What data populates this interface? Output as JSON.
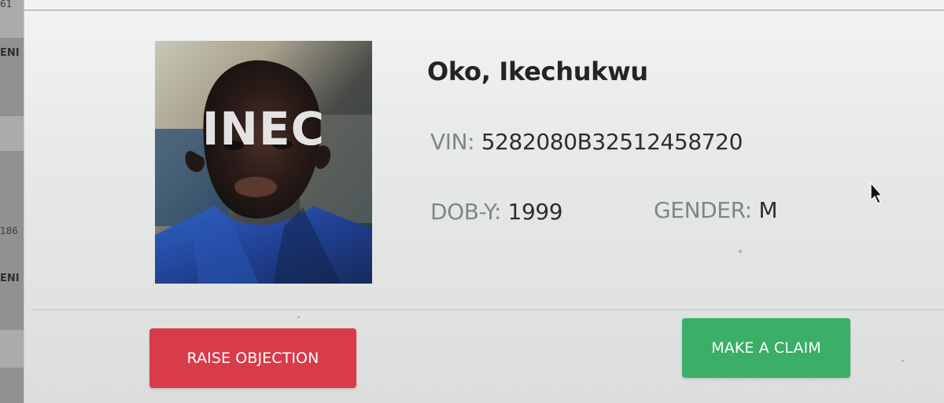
{
  "sidebar": {
    "fragments": [
      "61",
      "ENI",
      "186",
      "ENI"
    ]
  },
  "voter": {
    "name": "Oko, Ikechukwu",
    "photo_watermark": "INEC",
    "vin_label": "VIN:",
    "vin_value": "5282080B32512458720",
    "dob_label": "DOB-Y:",
    "dob_value": "1999",
    "gender_label": "GENDER:",
    "gender_value": "M"
  },
  "actions": {
    "raise_objection": "RAISE OBJECTION",
    "make_claim": "MAKE A CLAIM"
  },
  "colors": {
    "raise_button": "#d83b4a",
    "claim_button": "#3bae68",
    "sidebar": "#8f9290"
  },
  "icons": {
    "cursor": "mouse-pointer-icon"
  }
}
